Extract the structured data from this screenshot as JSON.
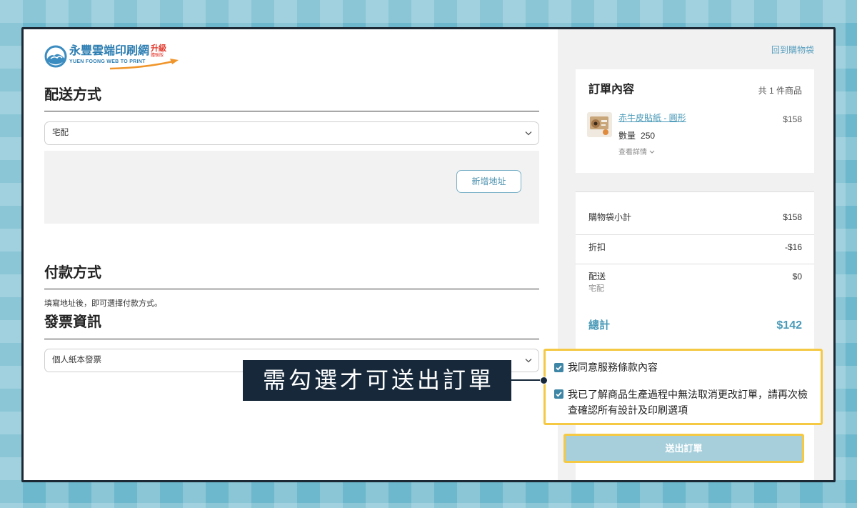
{
  "logo": {
    "name_zh": "永豐雲端印刷網",
    "badge": "升級",
    "badge_sub": "體驗版",
    "name_en": "YUEN FOONG WEB TO PRINT"
  },
  "shipping": {
    "heading": "配送方式",
    "method": "宅配",
    "add_address": "新增地址"
  },
  "payment": {
    "heading": "付款方式",
    "hint": "填寫地址後，即可選擇付款方式。"
  },
  "invoice": {
    "heading": "發票資訊",
    "type": "個人紙本發票"
  },
  "summary": {
    "back_link": "回到購物袋",
    "order": {
      "heading": "訂單內容",
      "count": "共 1 件商品",
      "item": {
        "name": "赤牛皮貼紙 - 圓形",
        "price": "$158",
        "qty_label": "數量",
        "qty": "250",
        "details": "查看詳情"
      }
    },
    "rows": [
      {
        "label": "購物袋小計",
        "value": "$158"
      },
      {
        "label": "折扣",
        "value": "-$16"
      },
      {
        "label": "配送",
        "value": "$0",
        "note": "宅配"
      }
    ],
    "total": {
      "label": "總計",
      "value": "$142"
    }
  },
  "agreements": [
    {
      "label": "我同意服務條款內容",
      "checked": true
    },
    {
      "label": "我已了解商品生產過程中無法取消更改訂單，請再次檢查確認所有設計及印刷選項",
      "checked": true
    }
  ],
  "submit_label": "送出訂單",
  "callout": "需勾選才可送出訂單",
  "icons": {
    "logo": "logo-mark-icon",
    "select": "chevron-down-icon",
    "details": "chevron-down-icon",
    "checkbox": "check-icon"
  },
  "colors": {
    "accent": "#4a9ab8",
    "highlight": "#f5c944",
    "callout_bg": "#16283a",
    "submit_bg": "#a6cfdb",
    "checkbox": "#3d86a5",
    "logo_blue": "#2f7fb3",
    "logo_red": "#e2372b"
  }
}
